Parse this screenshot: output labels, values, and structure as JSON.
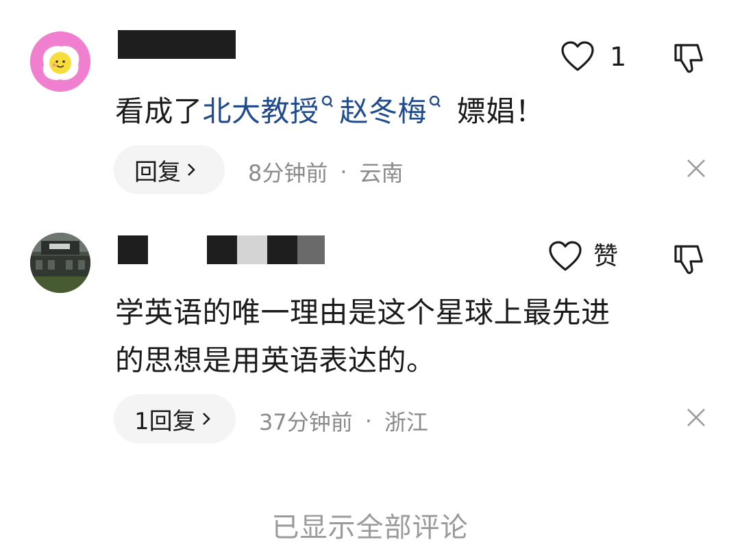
{
  "comments": [
    {
      "likes": "1",
      "text": {
        "prefix": "看成了",
        "keyword1": "北大教授",
        "keyword2": "赵冬梅",
        "suffix": " 嫖娼！"
      },
      "reply_label": "回复",
      "time": "8分钟前",
      "separator": "·",
      "location": "云南"
    },
    {
      "likes": "赞",
      "text_line1": "学英语的唯一理由是这个星球上最先进",
      "text_line2": "的思想是用英语表达的。",
      "reply_label": "1回复",
      "time": "37分钟前",
      "separator": "·",
      "location": "浙江"
    }
  ],
  "footer": "已显示全部评论",
  "icons": {
    "like": "heart-outline-icon",
    "dislike": "thumbs-down-icon",
    "close": "close-icon",
    "chevron": "chevron-right-icon",
    "search_mark": "search-icon"
  },
  "colors": {
    "keyword_link": "#1f4a8e",
    "meta_gray": "#8a8a8a",
    "footer_gray": "#9a9a9a",
    "pill_bg": "#f4f4f4",
    "avatar1_bg": "#f07fcf"
  }
}
